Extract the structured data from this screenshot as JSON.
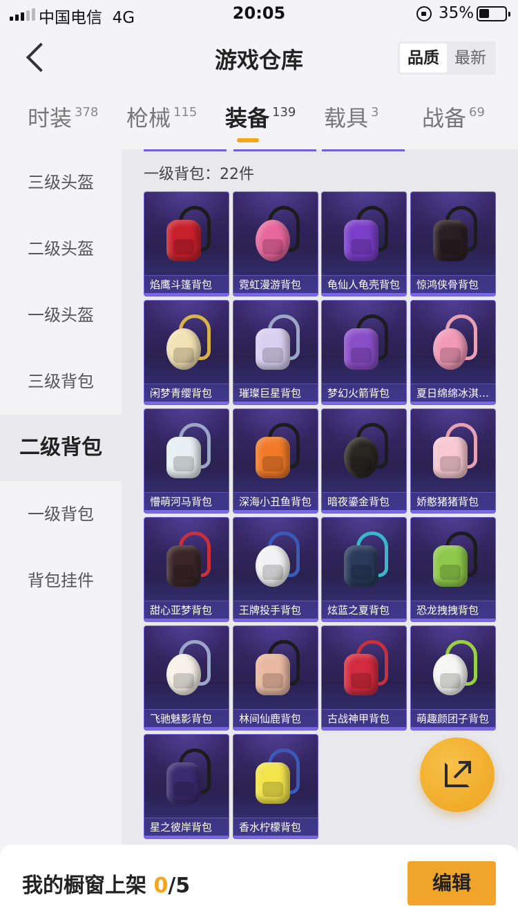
{
  "status_bar": {
    "carrier": "中国电信",
    "network": "4G",
    "time": "20:05",
    "battery": "35%"
  },
  "header": {
    "title": "游戏仓库",
    "sort_options": [
      "品质",
      "最新"
    ],
    "sort_active": "品质"
  },
  "tabs": [
    {
      "label": "时装",
      "count": "378"
    },
    {
      "label": "枪械",
      "count": "115"
    },
    {
      "label": "装备",
      "count": "139",
      "active": true
    },
    {
      "label": "载具",
      "count": "3"
    },
    {
      "label": "战备",
      "count": "69"
    }
  ],
  "sidebar": {
    "items": [
      "三级头盔",
      "二级头盔",
      "一级头盔",
      "三级背包",
      "二级背包",
      "一级背包",
      "背包挂件"
    ],
    "active": "二级背包"
  },
  "section": {
    "label": "一级背包：22件"
  },
  "items": [
    {
      "name": "焰鹰斗篷背包",
      "color": "#c8202c",
      "strap": "dark"
    },
    {
      "name": "霓虹漫游背包",
      "color": "#e8679c",
      "strap": "dark"
    },
    {
      "name": "龟仙人龟壳背包",
      "color": "#7a3ec8",
      "strap": "dark"
    },
    {
      "name": "惊鸿侠骨背包",
      "color": "#2a1f22",
      "strap": "dark"
    },
    {
      "name": "闲梦青缨背包",
      "color": "#f2e2b4",
      "strap": "gold"
    },
    {
      "name": "璀璨巨星背包",
      "color": "#d8d0f0",
      "strap": "light"
    },
    {
      "name": "梦幻火箭背包",
      "color": "#8a4ec8",
      "strap": "dark"
    },
    {
      "name": "夏日绵绵冰淇淋背包",
      "color": "#f29ab8",
      "strap": "pink"
    },
    {
      "name": "懵萌河马背包",
      "color": "#e6f0f2",
      "strap": "light"
    },
    {
      "name": "深海小丑鱼背包",
      "color": "#f07a28",
      "strap": "dark"
    },
    {
      "name": "暗夜鎏金背包",
      "color": "#2a2622",
      "strap": "dark"
    },
    {
      "name": "娇憨猪猪背包",
      "color": "#f7c8d0",
      "strap": "pink"
    },
    {
      "name": "甜心亚梦背包",
      "color": "#3a2628",
      "strap": "red"
    },
    {
      "name": "王牌投手背包",
      "color": "#f2f2f4",
      "strap": "blue"
    },
    {
      "name": "炫蓝之夏背包",
      "color": "#2a3a5a",
      "strap": "teal"
    },
    {
      "name": "恐龙拽拽背包",
      "color": "#8ec84a",
      "strap": "dark"
    },
    {
      "name": "飞驰魅影背包",
      "color": "#f6f2e8",
      "strap": "light"
    },
    {
      "name": "林间仙鹿背包",
      "color": "#e8b8a0",
      "strap": "dark"
    },
    {
      "name": "古战神甲背包",
      "color": "#d22a3e",
      "strap": "red"
    },
    {
      "name": "萌趣颜团子背包",
      "color": "#f6f6f4",
      "strap": "green"
    },
    {
      "name": "星之彼岸背包",
      "color": "#3a2a6e",
      "strap": "dark"
    },
    {
      "name": "香水柠檬背包",
      "color": "#f2e44a",
      "strap": "blue"
    }
  ],
  "bottom_bar": {
    "label": "我的橱窗上架",
    "current": "0",
    "total": "/5",
    "edit_label": "编辑"
  }
}
